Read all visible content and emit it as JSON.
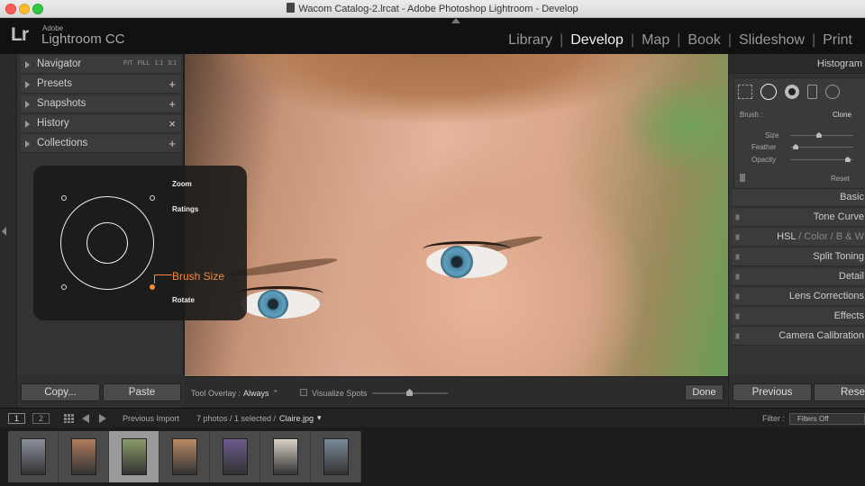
{
  "window": {
    "title": "Wacom Catalog-2.lrcat - Adobe Photoshop Lightroom - Develop"
  },
  "app": {
    "logo": "Lr",
    "brand_small": "Adobe",
    "brand_name": "Lightroom CC"
  },
  "modules": [
    {
      "label": "Library",
      "active": false
    },
    {
      "label": "Develop",
      "active": true
    },
    {
      "label": "Map",
      "active": false
    },
    {
      "label": "Book",
      "active": false
    },
    {
      "label": "Slideshow",
      "active": false
    },
    {
      "label": "Print",
      "active": false
    }
  ],
  "module_sep": "|",
  "left_panel": {
    "navigator": {
      "label": "Navigator",
      "modes": [
        "FIT",
        "FILL",
        "1:1",
        "3:1"
      ]
    },
    "presets": {
      "label": "Presets",
      "action": "+"
    },
    "snapshots": {
      "label": "Snapshots",
      "action": "+"
    },
    "history": {
      "label": "History",
      "action": "×"
    },
    "collections": {
      "label": "Collections",
      "action": "+"
    },
    "copy_label": "Copy...",
    "paste_label": "Paste"
  },
  "overlay": {
    "zoom": "Zoom",
    "ratings": "Ratings",
    "brush_size": "Brush Size",
    "rotate": "Rotate"
  },
  "toolbar": {
    "tool_overlay_label": "Tool Overlay :",
    "tool_overlay_value": "Always",
    "tool_overlay_arrow": "⌃",
    "visualize_spots": "Visualize Spots",
    "done": "Done"
  },
  "right_panel": {
    "histogram": "Histogram",
    "brush_label": "Brush :",
    "clone": "Clone",
    "size": "Size",
    "feather": "Feather",
    "opacity": "Opacity",
    "reset_small": "Reset",
    "sliders": {
      "size": 0.45,
      "feather": 0.05,
      "opacity": 0.95
    },
    "sections": {
      "basic": "Basic",
      "tone_curve": "Tone Curve",
      "hsl": "HSL",
      "color": "Color",
      "bw": "B & W",
      "slash": "/",
      "split_toning": "Split Toning",
      "detail": "Detail",
      "lens": "Lens Corrections",
      "effects": "Effects",
      "camera": "Camera Calibration"
    },
    "previous": "Previous",
    "reset": "Reset"
  },
  "filmstrip_bar": {
    "view1": "1",
    "view2": "2",
    "source": "Previous Import",
    "count": "7 photos / 1 selected /",
    "filename": "Claire.jpg",
    "dropdown": "▾",
    "filter_label": "Filter :",
    "filter_value": "Filters Off"
  },
  "filmstrip": {
    "thumbnails": [
      {
        "name": "thumb-1",
        "color": "#8a8f9c",
        "selected": false
      },
      {
        "name": "thumb-2",
        "color": "#b07c5e",
        "selected": false
      },
      {
        "name": "thumb-3",
        "color": "#8a9a6a",
        "selected": true
      },
      {
        "name": "thumb-4",
        "color": "#b98a63",
        "selected": false
      },
      {
        "name": "thumb-5",
        "color": "#6a5a8c",
        "selected": false
      },
      {
        "name": "thumb-6",
        "color": "#d8d0c6",
        "selected": false
      },
      {
        "name": "thumb-7",
        "color": "#7b8a9a",
        "selected": false
      }
    ]
  },
  "colors": {
    "accent": "#f08a3c"
  }
}
